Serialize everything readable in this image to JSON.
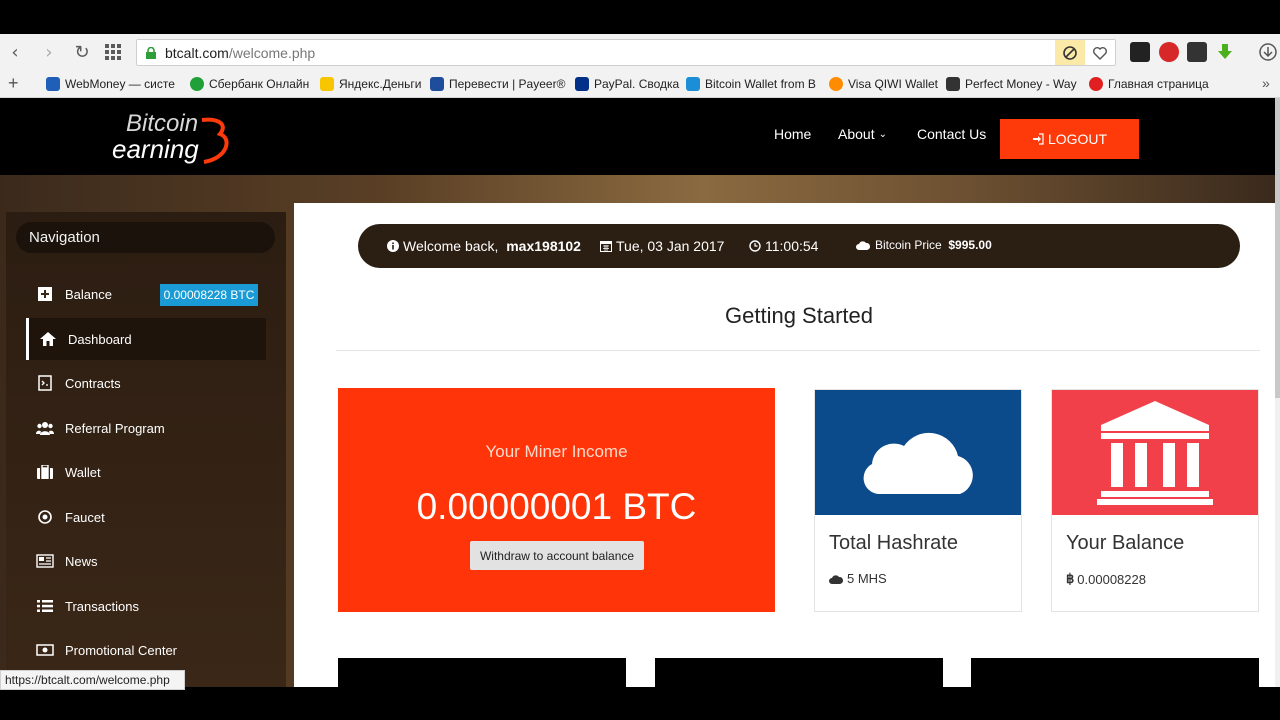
{
  "browser": {
    "url_host": "btcalt.com",
    "url_path": "/welcome.php",
    "status_url": "https://btcalt.com/welcome.php"
  },
  "bookmarks": [
    {
      "label": "WebMoney — систе",
      "color": "#1f5fb8"
    },
    {
      "label": "Сбербанк Онлайн",
      "color": "#21a038"
    },
    {
      "label": "Яндекс.Деньги",
      "color": "#f7c600"
    },
    {
      "label": "Перевести | Payeer®",
      "color": "#1e4d9b"
    },
    {
      "label": "PayPal. Сводка",
      "color": "#003087"
    },
    {
      "label": "Bitcoin Wallet from B",
      "color": "#1b8ed8"
    },
    {
      "label": "Visa QIWI Wallet",
      "color": "#ff8c00"
    },
    {
      "label": "Perfect Money - Way",
      "color": "#333333"
    },
    {
      "label": "Главная страница",
      "color": "#e02020"
    }
  ],
  "site": {
    "logo_line1": "Bitcoin",
    "logo_line2": "earning",
    "nav_home": "Home",
    "nav_about": "About",
    "nav_contact": "Contact Us",
    "logout_label": "LOGOUT"
  },
  "sidebar": {
    "title": "Navigation",
    "balance_badge": "0.00008228 BTC",
    "items": [
      {
        "label": "Balance",
        "icon": "plus-square-icon"
      },
      {
        "label": "Dashboard",
        "icon": "home-icon"
      },
      {
        "label": "Contracts",
        "icon": "contract-icon"
      },
      {
        "label": "Referral Program",
        "icon": "users-icon"
      },
      {
        "label": "Wallet",
        "icon": "suitcase-icon"
      },
      {
        "label": "Faucet",
        "icon": "target-icon"
      },
      {
        "label": "News",
        "icon": "newspaper-icon"
      },
      {
        "label": "Transactions",
        "icon": "list-icon"
      },
      {
        "label": "Promotional Center",
        "icon": "money-icon"
      }
    ]
  },
  "infobar": {
    "welcome_prefix": "Welcome back,",
    "username": "max198102",
    "date": "Tue, 03 Jan 2017",
    "time": "11:00:54",
    "price_label": "Bitcoin Price",
    "price_value": "$995.00"
  },
  "main": {
    "title": "Getting Started",
    "income_label": "Your Miner Income",
    "income_value": "0.00000001 BTC",
    "withdraw_label": "Withdraw to account balance",
    "hashrate_title": "Total Hashrate",
    "hashrate_value": "5 MHS",
    "balance_title": "Your Balance",
    "balance_value": "0.00008228"
  },
  "colors": {
    "accent_orange": "#ff3408",
    "hashrate_blue": "#0b4a8b",
    "balance_red": "#f2404a",
    "badge_blue": "#1a9bd6"
  }
}
